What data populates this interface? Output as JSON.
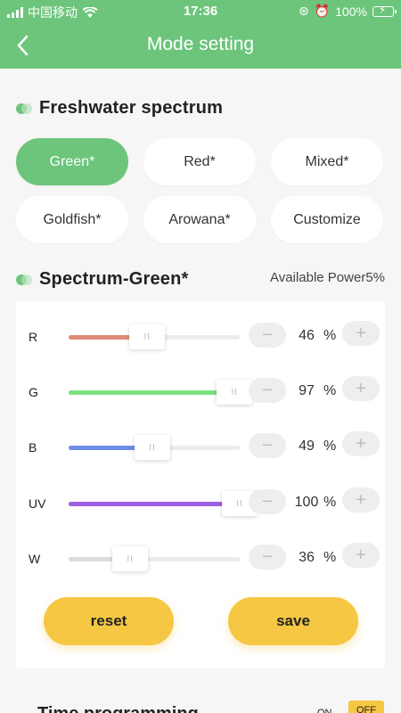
{
  "status_bar": {
    "carrier": "中国移动",
    "time": "17:36",
    "battery": "100%"
  },
  "header": {
    "title": "Mode setting"
  },
  "freshwater": {
    "title": "Freshwater spectrum",
    "modes": [
      "Green*",
      "Red*",
      "Mixed*",
      "Goldfish*",
      "Arowana*",
      "Customize"
    ],
    "selected": "Green*"
  },
  "spectrum": {
    "title": "Spectrum-Green*",
    "available_power": "Available Power5%",
    "unit": "%",
    "channels": [
      {
        "label": "R",
        "value": 46,
        "color": "#e08a78"
      },
      {
        "label": "G",
        "value": 97,
        "color": "#7ddf7f"
      },
      {
        "label": "B",
        "value": 49,
        "color": "#6c8ee6"
      },
      {
        "label": "UV",
        "value": 100,
        "color": "#9b5ee0"
      },
      {
        "label": "W",
        "value": 36,
        "color": "#dcdcdc"
      }
    ],
    "reset_label": "reset",
    "save_label": "save"
  },
  "time_programming": {
    "title": "Time programming",
    "on_label": "ON",
    "off_label": "OFF"
  },
  "colors": {
    "accent": "#6cc57b",
    "button": "#f5c743"
  }
}
